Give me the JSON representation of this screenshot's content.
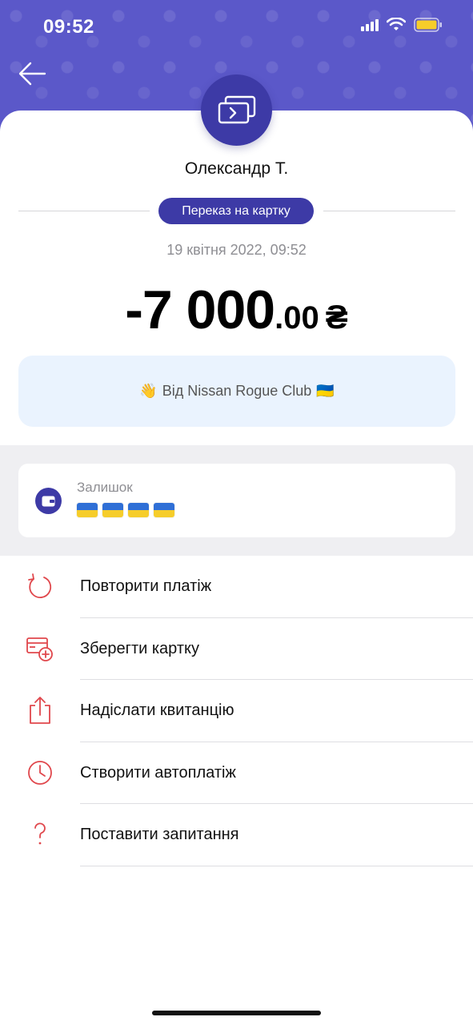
{
  "status_bar": {
    "time": "09:52",
    "icons": [
      "signal-icon",
      "wifi-icon",
      "battery-icon"
    ]
  },
  "header": {
    "back_icon": "arrow-left-icon",
    "transaction_icon": "card-transfer-icon"
  },
  "transaction": {
    "recipient": "Олександр Т.",
    "type": "Переказ на картку",
    "date": "19 квітня 2022, 09:52",
    "amount_int": "-7 000",
    "amount_dec": ".00",
    "currency": "₴",
    "comment_emoji": "👋",
    "comment": "Від Nissan Rogue Club",
    "comment_flag": "🇺🇦"
  },
  "balance": {
    "label": "Залишок",
    "icon": "wallet-icon",
    "flags_count": 4
  },
  "actions": [
    {
      "label": "Повторити платіж",
      "icon": "repeat-icon"
    },
    {
      "label": "Зберегти картку",
      "icon": "save-card-icon"
    },
    {
      "label": "Надіслати квитанцію",
      "icon": "share-icon"
    },
    {
      "label": "Створити автоплатіж",
      "icon": "clock-icon"
    },
    {
      "label": "Поставити запитання",
      "icon": "question-icon"
    }
  ],
  "colors": {
    "header_bg": "#5b58c9",
    "accent": "#3d3aa6",
    "action_icon": "#e0474c",
    "comment_bg": "#eaf3fe"
  }
}
